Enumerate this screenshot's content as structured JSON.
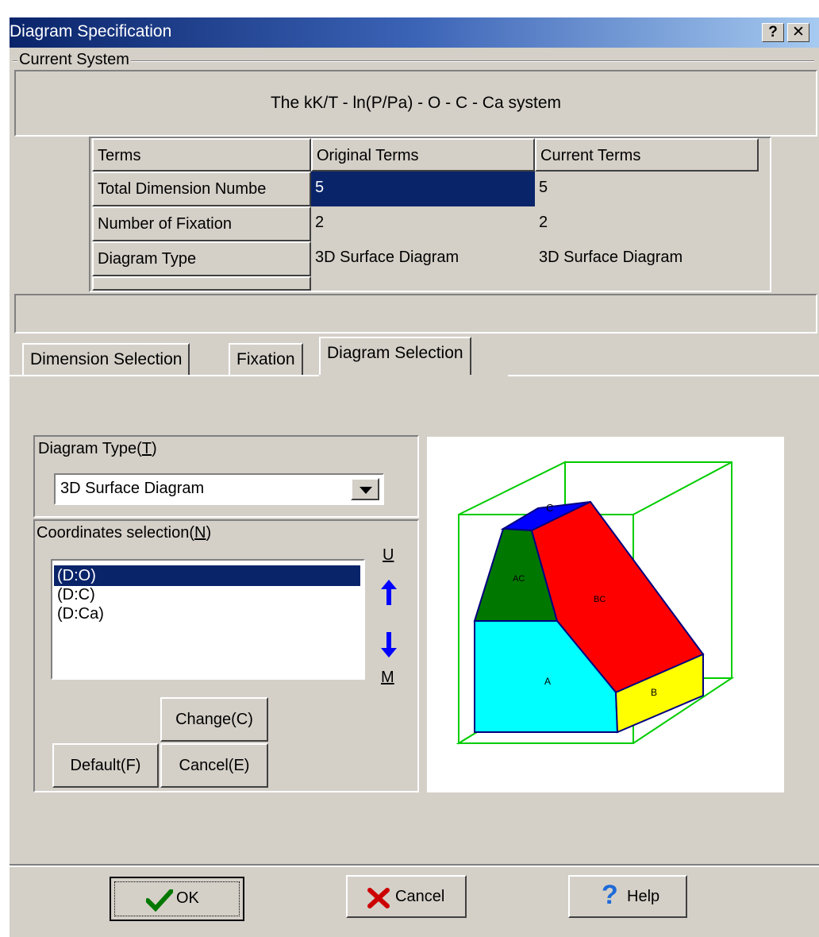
{
  "window": {
    "title": "Diagram Specification",
    "help_button": "?",
    "close_button": "✕"
  },
  "current_system": {
    "group_label": "Current System",
    "system_text": "The kK/T - ln(P/Pa) - O - C - Ca system",
    "table": {
      "headers": [
        "Terms",
        "Original Terms",
        "Current Terms"
      ],
      "rows": [
        {
          "term": "Total Dimension Numbe",
          "original": "5",
          "current": "5"
        },
        {
          "term": "Number of Fixation",
          "original": "2",
          "current": "2"
        },
        {
          "term": "Diagram Type",
          "original": "3D Surface Diagram",
          "current": "3D Surface Diagram"
        }
      ]
    }
  },
  "tabs": [
    {
      "label": "Dimension Selection",
      "active": false
    },
    {
      "label": "Fixation",
      "active": false
    },
    {
      "label": "Diagram Selection",
      "active": true
    }
  ],
  "diagram_selection": {
    "diagram_type_label": "Diagram Type(",
    "diagram_type_key": "T",
    "diagram_type_value": "3D Surface Diagram",
    "coordinates_label": "Coordinates selection(",
    "coordinates_key": "N",
    "coordinates": [
      "(D:O)",
      "(D:C)",
      "(D:Ca)"
    ],
    "selected_index": 0,
    "up_label": "U",
    "down_label": "M",
    "change_button": "Change(C)",
    "default_button": "Default(F)",
    "cancel_button": "Cancel(E)"
  },
  "preview_labels": {
    "top": "C",
    "left": "AC",
    "right": "BC",
    "front": "A",
    "side": "B"
  },
  "footer": {
    "ok": "OK",
    "cancel": "Cancel",
    "help": "Help"
  },
  "colors": {
    "title_start": "#0a246a",
    "selection": "#0a246a",
    "arrow": "#0000ff",
    "red": "#ff0000",
    "green": "#007800",
    "cyan": "#00ffff",
    "yellow": "#ffff00",
    "blue": "#0000ff",
    "box_line": "#00cc00"
  }
}
